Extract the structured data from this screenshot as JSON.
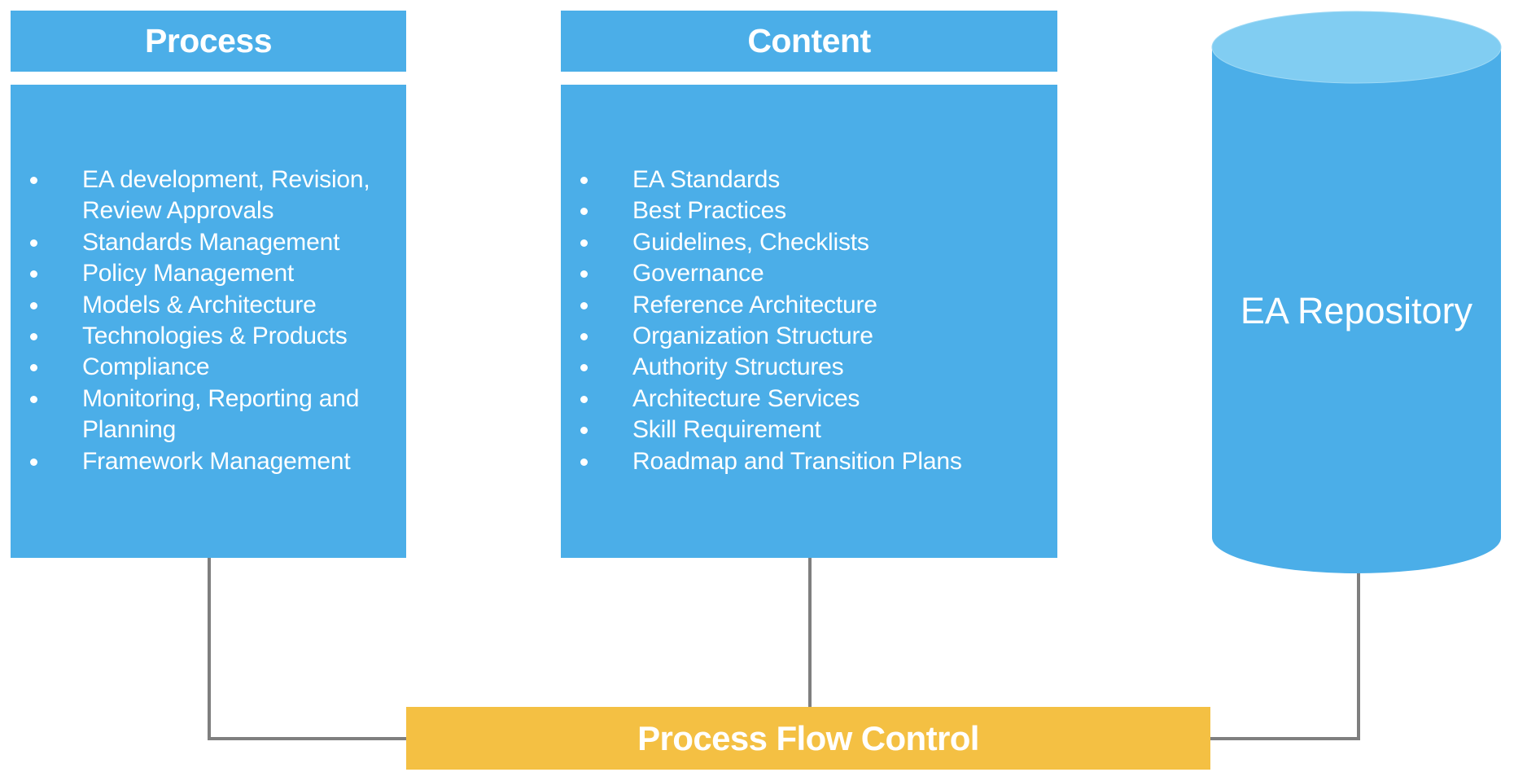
{
  "diagram": {
    "process": {
      "title": "Process",
      "items": [
        {
          "label": "EA development, Revision, Review Approvals",
          "lines": [
            "EA development, Revision,",
            "Review Approvals"
          ]
        },
        {
          "label": "Standards Management",
          "lines": [
            "Standards Management"
          ]
        },
        {
          "label": "Policy Management",
          "lines": [
            "Policy Management"
          ]
        },
        {
          "label": "Models & Architecture",
          "lines": [
            "Models & Architecture"
          ]
        },
        {
          "label": "Technologies & Products",
          "lines": [
            "Technologies & Products"
          ]
        },
        {
          "label": "Compliance",
          "lines": [
            "Compliance"
          ]
        },
        {
          "label": "Monitoring, Reporting and Planning",
          "lines": [
            "Monitoring, Reporting and",
            "Planning"
          ]
        },
        {
          "label": "Framework Management",
          "lines": [
            "Framework Management"
          ]
        }
      ]
    },
    "content": {
      "title": "Content",
      "items": [
        {
          "label": "EA Standards",
          "lines": [
            "EA Standards"
          ]
        },
        {
          "label": "Best Practices",
          "lines": [
            "Best Practices"
          ]
        },
        {
          "label": "Guidelines, Checklists",
          "lines": [
            "Guidelines, Checklists"
          ]
        },
        {
          "label": "Governance",
          "lines": [
            "Governance"
          ]
        },
        {
          "label": "Reference Architecture",
          "lines": [
            "Reference Architecture"
          ]
        },
        {
          "label": "Organization Structure",
          "lines": [
            "Organization Structure"
          ]
        },
        {
          "label": "Authority Structures",
          "lines": [
            "Authority Structures"
          ]
        },
        {
          "label": "Architecture Services",
          "lines": [
            "Architecture Services"
          ]
        },
        {
          "label": "Skill Requirement",
          "lines": [
            "Skill Requirement"
          ]
        },
        {
          "label": "Roadmap and Transition Plans",
          "lines": [
            "Roadmap and Transition Plans"
          ]
        }
      ]
    },
    "repository": {
      "label": "EA Repository",
      "shape": "cylinder-icon"
    },
    "flow_control": {
      "label": "Process Flow Control"
    },
    "connections": [
      {
        "from": "Process",
        "to": "Process Flow Control"
      },
      {
        "from": "Content",
        "to": "Process Flow Control"
      },
      {
        "from": "EA Repository",
        "to": "Process Flow Control"
      }
    ],
    "colors": {
      "box_blue": "#4BAEE8",
      "cylinder_top": "#81CDF2",
      "flow_yellow": "#F4C043",
      "connector_gray": "#7F7F7F",
      "text": "#FFFFFF"
    }
  }
}
